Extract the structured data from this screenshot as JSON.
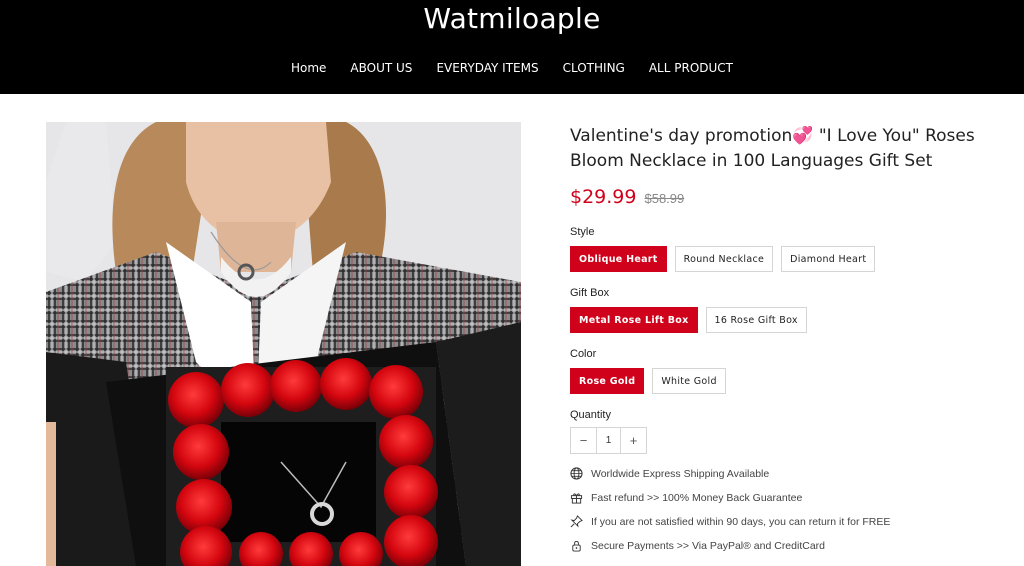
{
  "header": {
    "brand": "Watmiloaple",
    "nav": [
      "Home",
      "ABOUT US",
      "EVERYDAY ITEMS",
      "CLOTHING",
      "ALL PRODUCT"
    ]
  },
  "product": {
    "title_part1": "Valentine's day promotion",
    "title_emoji": "💞",
    "title_part2": " \"I Love You\" Roses Bloom Necklace in 100 Languages Gift Set",
    "price": "$29.99",
    "compare_price": "$58.99",
    "options": {
      "style": {
        "label": "Style",
        "values": [
          "Oblique Heart",
          "Round Necklace",
          "Diamond Heart"
        ],
        "selected": "Oblique Heart"
      },
      "gift_box": {
        "label": "Gift Box",
        "values": [
          "Metal Rose Lift Box",
          "16 Rose Gift Box"
        ],
        "selected": "Metal Rose Lift Box"
      },
      "color": {
        "label": "Color",
        "values": [
          "Rose Gold",
          "White Gold"
        ],
        "selected": "Rose Gold"
      }
    },
    "quantity": {
      "label": "Quantity",
      "value": "1",
      "minus": "−",
      "plus": "+"
    },
    "features": [
      {
        "icon": "globe-icon",
        "text": "Worldwide Express Shipping Available"
      },
      {
        "icon": "gift-icon",
        "text": "Fast refund >> 100% Money Back Guarantee"
      },
      {
        "icon": "pin-icon",
        "text": "If you are not satisfied within 90 days, you can return it for FREE"
      },
      {
        "icon": "lock-icon",
        "text": "Secure Payments >> Via PayPal® and CreditCard"
      }
    ]
  },
  "colors": {
    "accent": "#d0021b",
    "header_bg": "#000000"
  }
}
